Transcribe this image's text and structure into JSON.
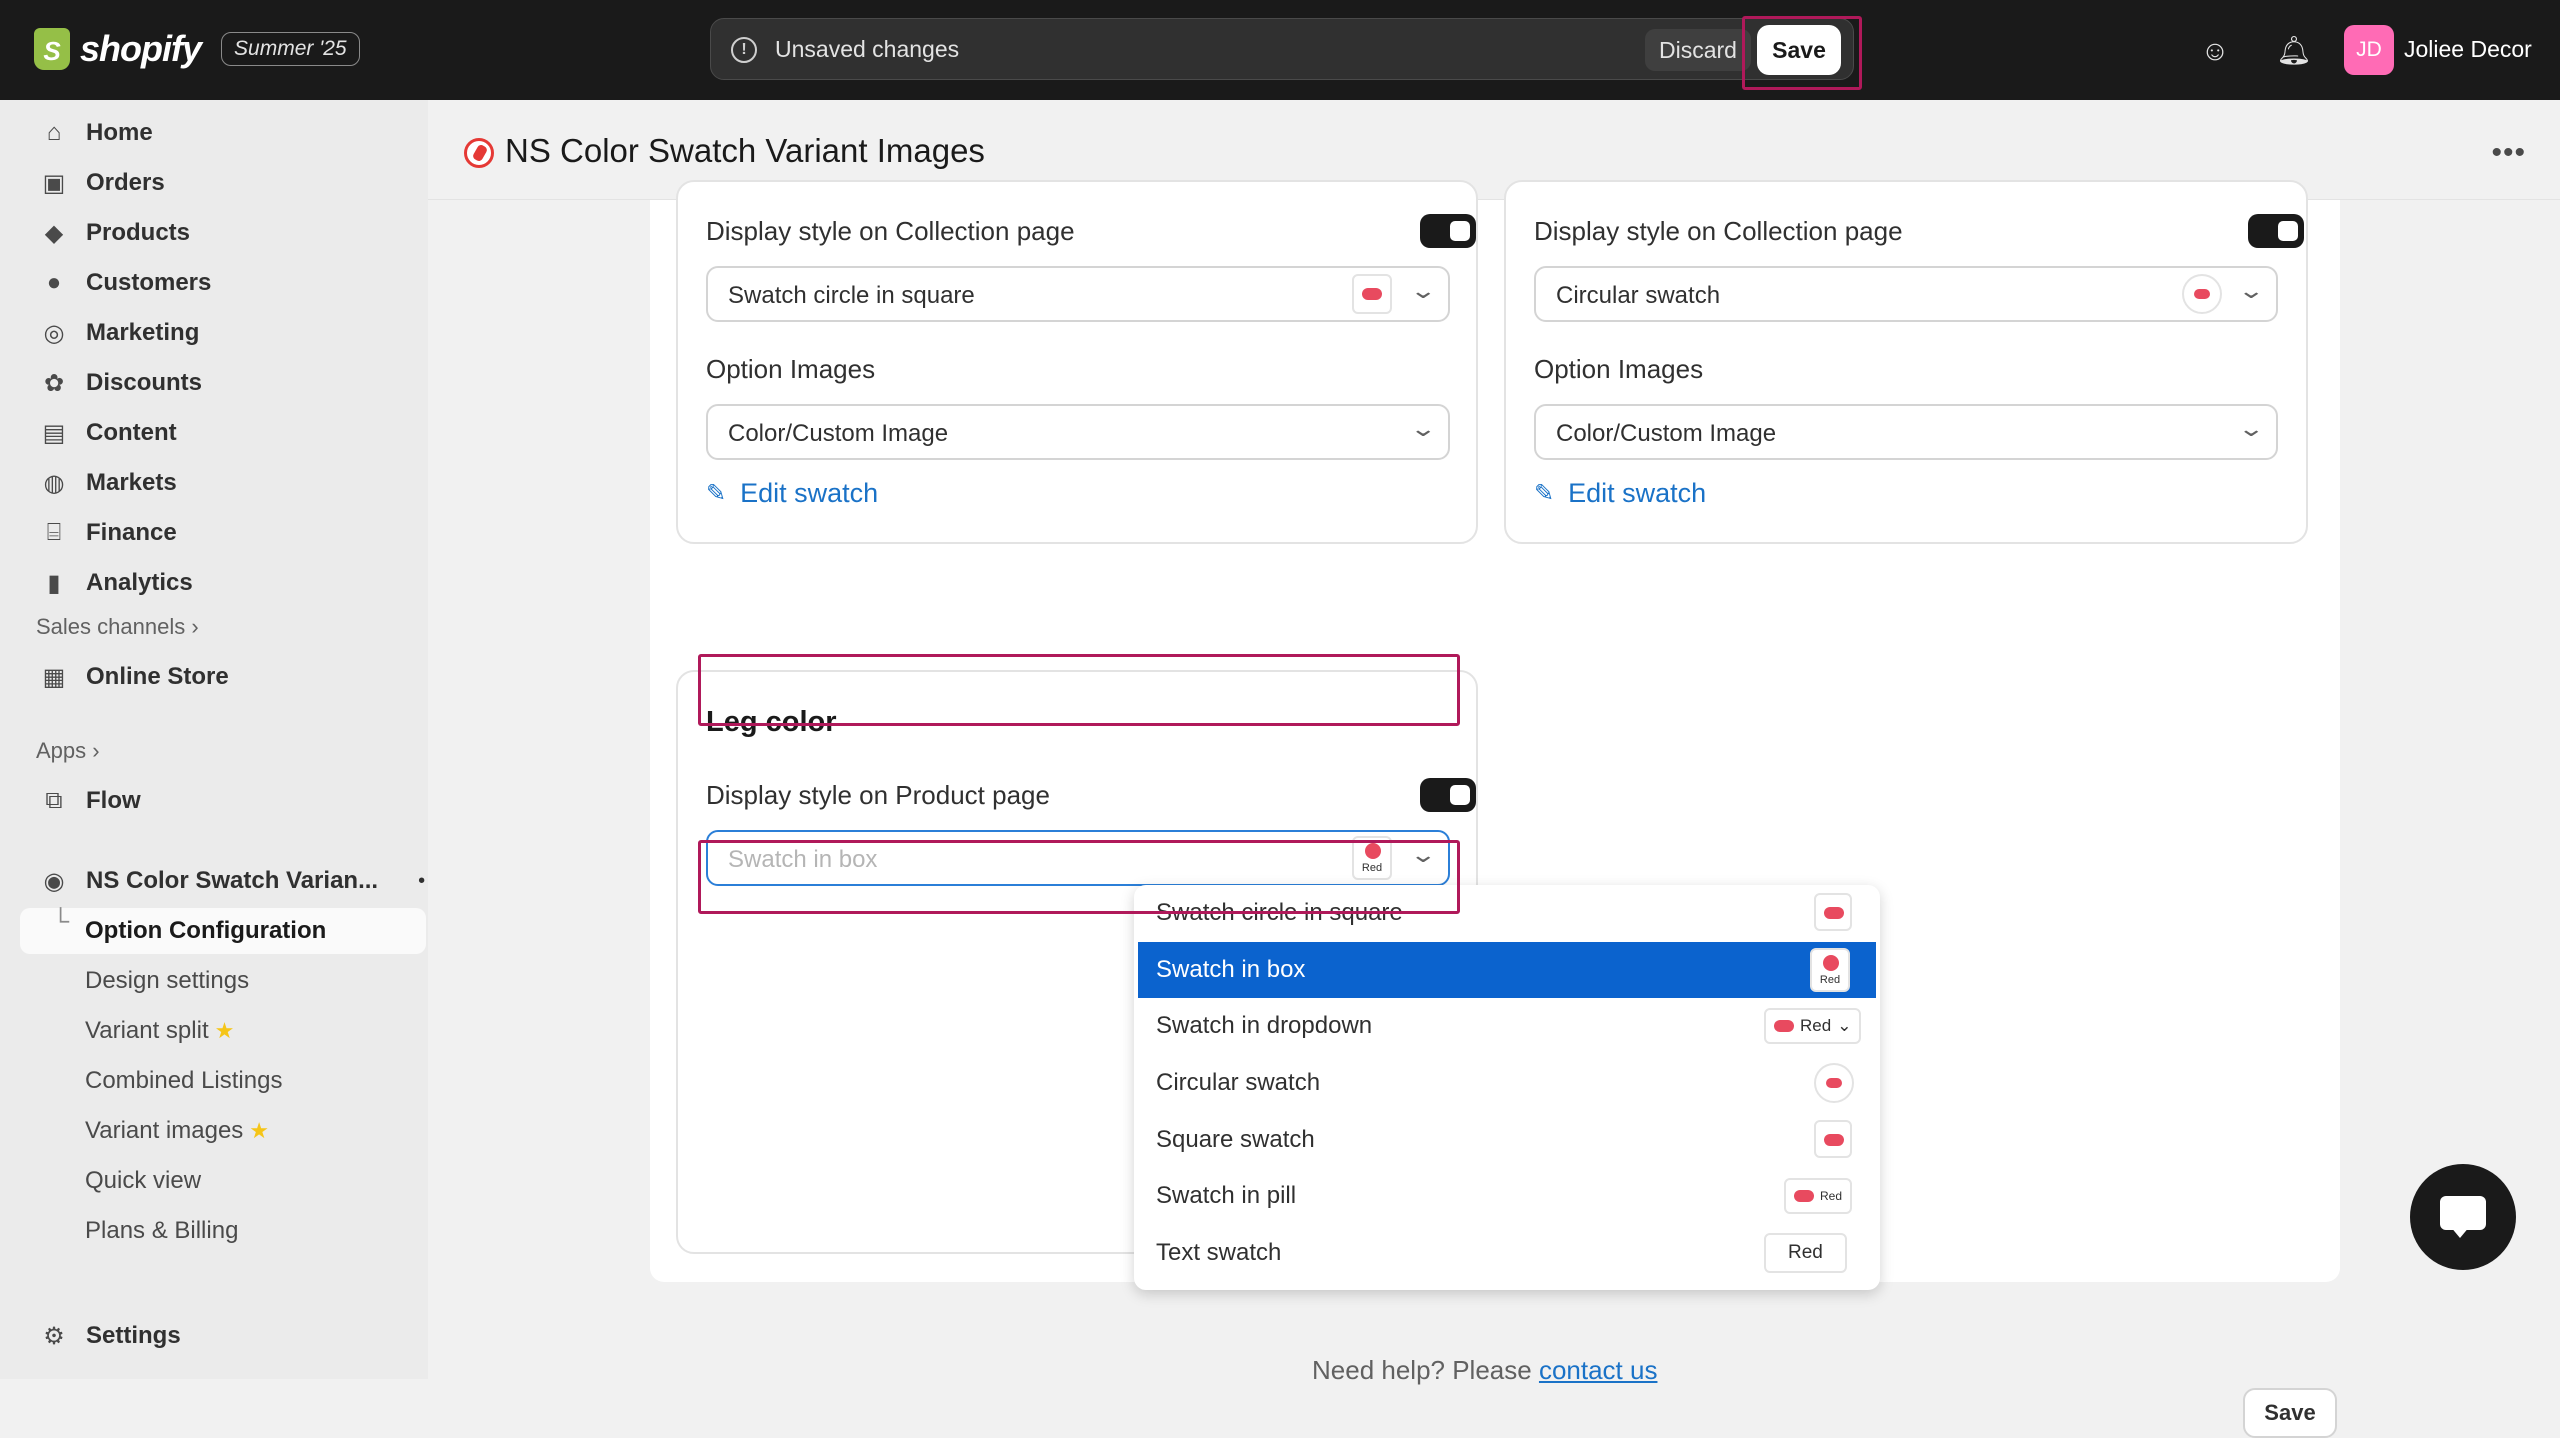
{
  "topbar": {
    "brand": "shopify",
    "edition": "Summer '25",
    "unsaved_message": "Unsaved changes",
    "discard_label": "Discard",
    "save_label": "Save",
    "avatar_initials": "JD",
    "store_name": "Joliee Decor"
  },
  "sidebar": {
    "items": [
      {
        "label": "Home",
        "icon": "home-icon"
      },
      {
        "label": "Orders",
        "icon": "orders-icon"
      },
      {
        "label": "Products",
        "icon": "tag-icon"
      },
      {
        "label": "Customers",
        "icon": "person-icon"
      },
      {
        "label": "Marketing",
        "icon": "target-icon"
      },
      {
        "label": "Discounts",
        "icon": "discount-icon"
      },
      {
        "label": "Content",
        "icon": "content-icon"
      },
      {
        "label": "Markets",
        "icon": "globe-icon"
      },
      {
        "label": "Finance",
        "icon": "bank-icon"
      },
      {
        "label": "Analytics",
        "icon": "bar-chart-icon"
      }
    ],
    "sales_channels_label": "Sales channels",
    "online_store_label": "Online Store",
    "apps_label": "Apps",
    "flow_label": "Flow",
    "app_name": "NS Color Swatch Varian...",
    "app_subitems": [
      "Option Configuration",
      "Design settings",
      "Variant split",
      "Combined Listings",
      "Variant images",
      "Quick view",
      "Plans & Billing"
    ],
    "settings_label": "Settings"
  },
  "page": {
    "title": "NS Color Swatch Variant Images"
  },
  "left_card": {
    "collection_label": "Display style on Collection page",
    "collection_value": "Swatch circle in square",
    "option_images_label": "Option Images",
    "option_images_value": "Color/Custom Image",
    "edit_label": "Edit swatch"
  },
  "right_card": {
    "collection_label": "Display style on Collection page",
    "collection_value": "Circular swatch",
    "option_images_label": "Option Images",
    "option_images_value": "Color/Custom Image",
    "edit_label": "Edit swatch"
  },
  "leg_card": {
    "title": "Leg color",
    "product_label": "Display style on Product page",
    "product_value": "Swatch in box",
    "swatch_text": "Red"
  },
  "dropdown": {
    "options": [
      "Swatch circle in square",
      "Swatch in box",
      "Swatch in dropdown",
      "Circular swatch",
      "Square swatch",
      "Swatch in pill",
      "Text swatch"
    ],
    "selected": "Swatch in box",
    "preview_text": "Red"
  },
  "footer": {
    "help_text": "Need help? Please",
    "help_link": "contact us",
    "save_label": "Save"
  },
  "colors": {
    "highlight": "#b0195a",
    "selected": "#0b63ce",
    "link": "#1a72c7",
    "swatch": "#e84a5f"
  }
}
